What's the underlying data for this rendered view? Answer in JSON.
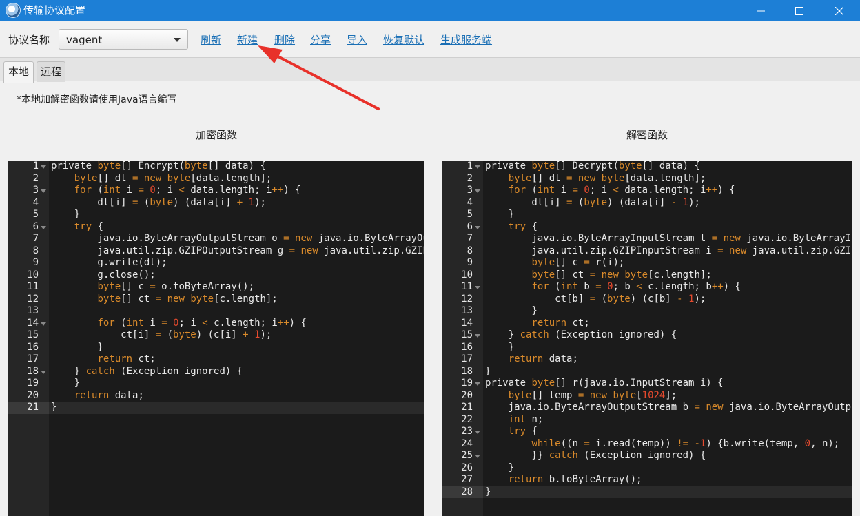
{
  "window": {
    "title": "传输协议配置",
    "accent": "#1d7fd6"
  },
  "toolbar": {
    "protocol_label": "协议名称",
    "protocol_value": "vagent",
    "links": [
      "刷新",
      "新建",
      "删除",
      "分享",
      "导入",
      "恢复默认",
      "生成服务端"
    ]
  },
  "tabs": [
    "本地",
    "远程"
  ],
  "note": "*本地加解密函数请使用Java语言编写",
  "encrypt": {
    "title": "加密函数",
    "lines": [
      "private byte[] Encrypt(byte[] data) {",
      "    byte[] dt = new byte[data.length];",
      "    for (int i = 0; i < data.length; i++) {",
      "        dt[i] = (byte) (data[i] + 1);",
      "    }",
      "    try {",
      "        java.io.ByteArrayOutputStream o = new java.io.ByteArrayOut",
      "        java.util.zip.GZIPOutputStream g = new java.util.zip.GZIPO",
      "        g.write(dt);",
      "        g.close();",
      "        byte[] c = o.toByteArray();",
      "        byte[] ct = new byte[c.length];",
      "",
      "        for (int i = 0; i < c.length; i++) {",
      "            ct[i] = (byte) (c[i] + 1);",
      "        }",
      "        return ct;",
      "    } catch (Exception ignored) {",
      "    }",
      "    return data;",
      "}"
    ]
  },
  "decrypt": {
    "title": "解密函数",
    "lines": [
      "private byte[] Decrypt(byte[] data) {",
      "    byte[] dt = new byte[data.length];",
      "    for (int i = 0; i < data.length; i++) {",
      "        dt[i] = (byte) (data[i] - 1);",
      "    }",
      "    try {",
      "        java.io.ByteArrayInputStream t = new java.io.ByteArrayInp",
      "        java.util.zip.GZIPInputStream i = new java.util.zip.GZIPI",
      "        byte[] c = r(i);",
      "        byte[] ct = new byte[c.length];",
      "        for (int b = 0; b < c.length; b++) {",
      "            ct[b] = (byte) (c[b] - 1);",
      "        }",
      "        return ct;",
      "    } catch (Exception ignored) {",
      "    }",
      "    return data;",
      "}",
      "private byte[] r(java.io.InputStream i) {",
      "    byte[] temp = new byte[1024];",
      "    java.io.ByteArrayOutputStream b = new java.io.ByteArrayOutput",
      "    int n;",
      "    try {",
      "        while((n = i.read(temp)) != -1) {b.write(temp, 0, n);",
      "        }} catch (Exception ignored) {",
      "    }",
      "    return b.toByteArray();",
      "}"
    ]
  }
}
